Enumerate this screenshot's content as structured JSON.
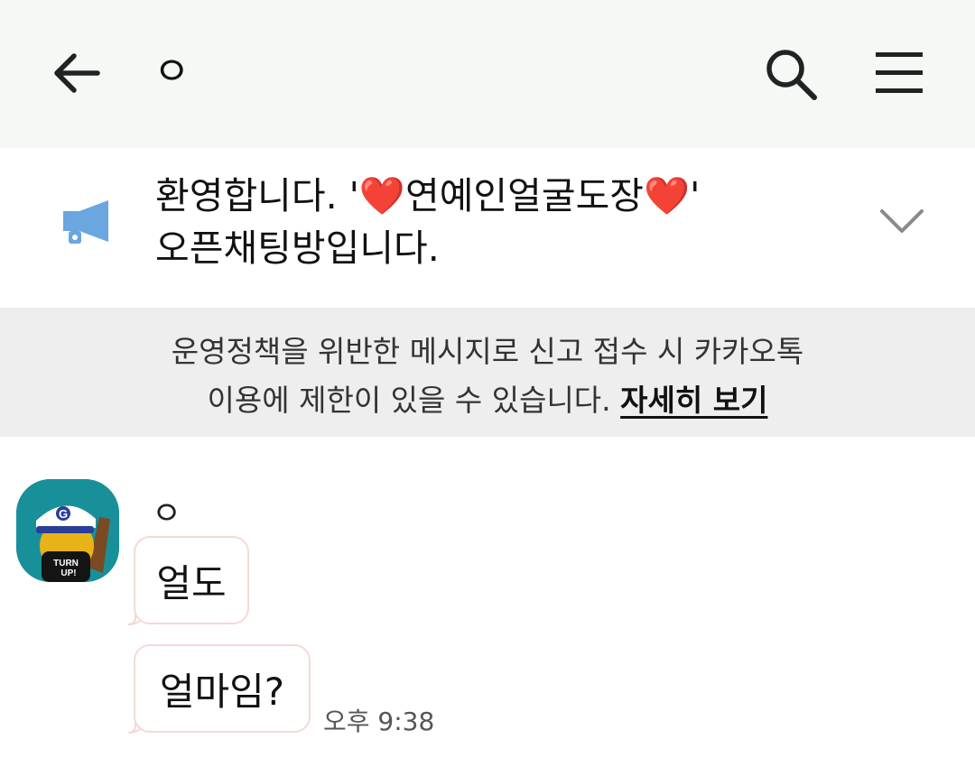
{
  "header": {
    "title": "ㅇ",
    "back_icon": "arrow-left-icon",
    "search_icon": "search-icon",
    "menu_icon": "hamburger-menu-icon",
    "background": "#f4f9f5"
  },
  "notice": {
    "icon": "megaphone-icon",
    "text": "환영합니다. '❤️연예인얼굴도장❤️'\n오픈채팅방입니다.",
    "chevron_icon": "chevron-down-icon",
    "icon_color": "#6aa6e0"
  },
  "policy": {
    "line1": "운영정책을 위반한 메시지로 신고 접수 시 카카오톡",
    "line2_prefix": "이용에 제한이 있을 수 있습니다. ",
    "link_label": "자세히 보기"
  },
  "messages": {
    "sender_name": "ㅇ",
    "avatar": {
      "cap_letter": "G",
      "shirt_text_1": "TURN",
      "shirt_text_2": "UP!"
    },
    "items": [
      {
        "text": "얼도"
      },
      {
        "text": "얼마임?"
      }
    ],
    "timestamp": "오후 9:38",
    "bubble_border_color": "#f4d9d5"
  }
}
